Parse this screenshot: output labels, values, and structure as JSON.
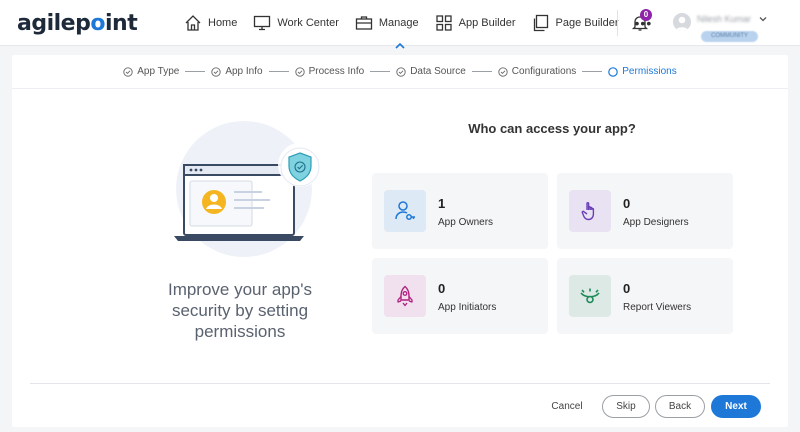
{
  "brand": {
    "logo_text": "agilep",
    "logo_dot": "o",
    "logo_tail": "int"
  },
  "nav": {
    "items": [
      {
        "label": "Home",
        "icon": "home-icon"
      },
      {
        "label": "Work Center",
        "icon": "monitor-icon"
      },
      {
        "label": "Manage",
        "icon": "briefcase-icon"
      },
      {
        "label": "App Builder",
        "icon": "grid-icon"
      },
      {
        "label": "Page Builder",
        "icon": "pages-icon"
      }
    ],
    "more": "•••",
    "notification_count": "0"
  },
  "user": {
    "name": "Nilesh Kumar",
    "role": "COMMUNITY"
  },
  "stepper": {
    "steps": [
      {
        "label": "App Type"
      },
      {
        "label": "App Info"
      },
      {
        "label": "Process Info"
      },
      {
        "label": "Data Source"
      },
      {
        "label": "Configurations"
      },
      {
        "label": "Permissions"
      }
    ]
  },
  "left": {
    "text": "Improve your app's security by setting permissions"
  },
  "main": {
    "title": "Who can access your app?",
    "tiles": [
      {
        "count": "1",
        "label": "App Owners",
        "icon": "user-key-icon",
        "bg": "#dde9f4",
        "color": "#1e78d8"
      },
      {
        "count": "0",
        "label": "App Designers",
        "icon": "hand-pointer-icon",
        "bg": "#e8e2f3",
        "color": "#6a3fb5"
      },
      {
        "count": "0",
        "label": "App Initiators",
        "icon": "rocket-icon",
        "bg": "#f1e0ee",
        "color": "#b0207f"
      },
      {
        "count": "0",
        "label": "Report Viewers",
        "icon": "eye-icon",
        "bg": "#dde9e4",
        "color": "#1d8a5a"
      }
    ]
  },
  "footer": {
    "cancel": "Cancel",
    "skip": "Skip",
    "back": "Back",
    "next": "Next"
  },
  "colors": {
    "accent": "#1e78d8",
    "badge": "#8e24aa"
  }
}
